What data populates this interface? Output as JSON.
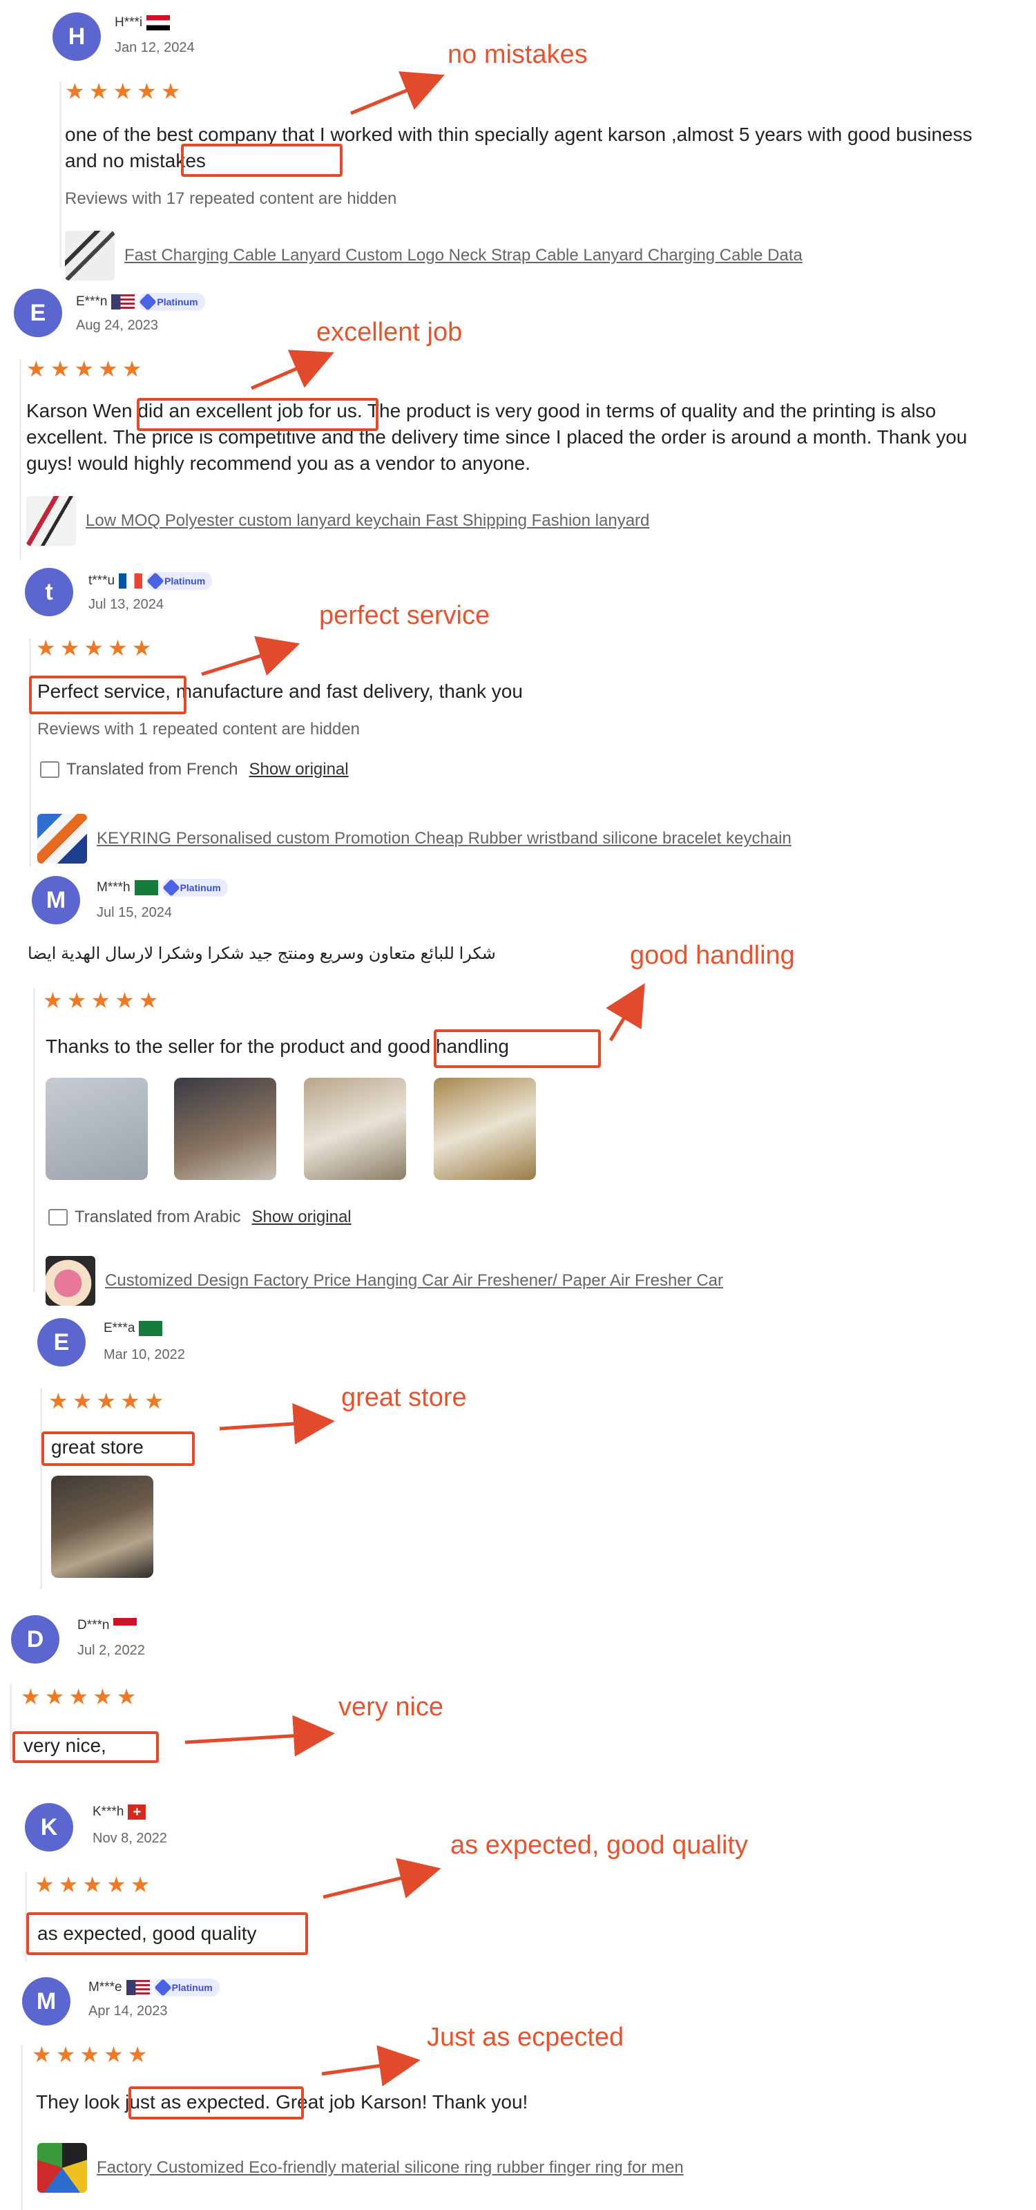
{
  "accent_star_color": "#f07a24",
  "annotation_color": "#e24a2c",
  "reviews": [
    {
      "avatar": "H",
      "user": "H***i",
      "date": "Jan 12, 2024",
      "stars": "★★★★★",
      "text": "one of the best company that I worked with thin specially agent karson ,almost 5 years with good business and no mistakes",
      "hidden_note": "Reviews with 17 repeated content are hidden",
      "product": "Fast Charging Cable Lanyard Custom Logo Neck Strap Cable Lanyard Charging Cable Data",
      "annotation": "no mistakes"
    },
    {
      "avatar": "E",
      "user": "E***n",
      "badge": "Platinum",
      "date": "Aug 24, 2023",
      "stars": "★★★★★",
      "text": "Karson Wen did an excellent job for us. The product is very good in terms of quality and the printing is also excellent. The price is competitive and the delivery time since I placed the order is around a month. Thank you guys! would highly recommend you as a vendor to anyone.",
      "product": "Low MOQ Polyester custom lanyard keychain Fast Shipping Fashion lanyard",
      "annotation": "excellent job"
    },
    {
      "avatar": "t",
      "user": "t***u",
      "badge": "Platinum",
      "date": "Jul 13, 2024",
      "stars": "★★★★★",
      "text": "Perfect service, manufacture and fast delivery, thank you",
      "hidden_note": "Reviews with 1 repeated content are hidden",
      "translated": "Translated from French",
      "show_original": "Show original",
      "product": "KEYRING Personalised custom Promotion Cheap Rubber wristband silicone bracelet keychain",
      "annotation": "perfect service"
    },
    {
      "avatar": "M",
      "user": "M***h",
      "badge": "Platinum",
      "date": "Jul 15, 2024",
      "stars": "★★★★★",
      "original_text": "شكرا للبائع متعاون وسريع ومنتج جيد شكرا وشكرا لارسال الهدية ايضا",
      "text": "Thanks to the seller for the product and good handling",
      "translated": "Translated from Arabic",
      "show_original": "Show original",
      "product": "Customized Design Factory Price Hanging Car Air Freshener/ Paper Air Fresher Car",
      "annotation": "good handling"
    },
    {
      "avatar": "E",
      "user": "E***a",
      "date": "Mar 10, 2022",
      "stars": "★★★★★",
      "text": "great store",
      "annotation": "great store"
    },
    {
      "avatar": "D",
      "user": "D***n",
      "date": "Jul 2, 2022",
      "stars": "★★★★★",
      "text": "very nice,",
      "annotation": "very nice"
    },
    {
      "avatar": "K",
      "user": "K***h",
      "date": "Nov 8, 2022",
      "stars": "★★★★★",
      "text": "as expected, good quality",
      "annotation": "as expected, good quality"
    },
    {
      "avatar": "M",
      "user": "M***e",
      "badge": "Platinum",
      "date": "Apr 14, 2023",
      "stars": "★★★★★",
      "text": "They look just as expected. Great job Karson! Thank you!",
      "product": "Factory Customized Eco-friendly material silicone ring rubber finger ring for men",
      "annotation": "Just as ecpected"
    }
  ]
}
